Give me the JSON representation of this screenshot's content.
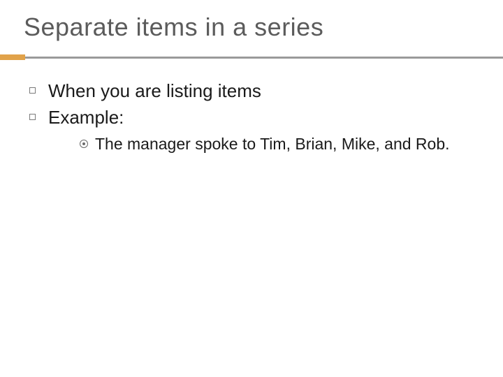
{
  "title": "Separate items in a series",
  "bullets": {
    "item1": "When you are listing items",
    "item2": "Example:",
    "sub1": "The manager spoke to Tim, Brian, Mike, and Rob."
  }
}
